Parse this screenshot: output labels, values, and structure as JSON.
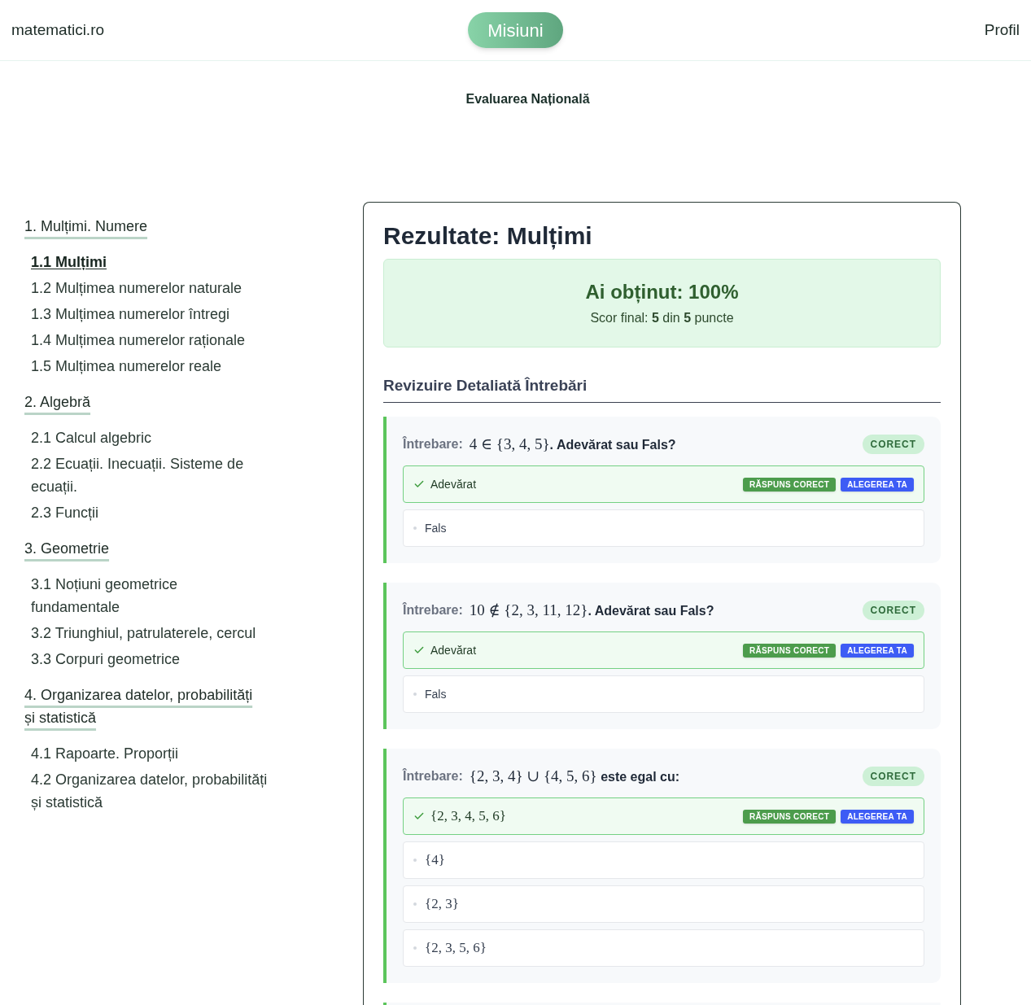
{
  "header": {
    "site_name": "matematici.ro",
    "nav_button": "Misiuni",
    "profile_link": "Profil"
  },
  "page_title": "Evaluarea Națională",
  "sidebar": {
    "sections": [
      {
        "title": "1. Mulțimi. Numere",
        "items": [
          {
            "label": "1.1 Mulțimi",
            "selected": true
          },
          {
            "label": "1.2 Mulțimea numerelor naturale",
            "selected": false
          },
          {
            "label": "1.3 Mulțimea numerelor întregi",
            "selected": false
          },
          {
            "label": "1.4 Mulțimea numerelor raționale",
            "selected": false
          },
          {
            "label": "1.5 Mulțimea numerelor reale",
            "selected": false
          }
        ]
      },
      {
        "title": "2. Algebră",
        "items": [
          {
            "label": "2.1 Calcul algebric",
            "selected": false
          },
          {
            "label": "2.2 Ecuații. Inecuații. Sisteme de ecuații.",
            "selected": false
          },
          {
            "label": "2.3 Funcții",
            "selected": false
          }
        ]
      },
      {
        "title": "3. Geometrie",
        "items": [
          {
            "label": "3.1 Noțiuni geometrice fundamentale",
            "selected": false
          },
          {
            "label": "3.2 Triunghiul, patrulaterele, cercul",
            "selected": false
          },
          {
            "label": "3.3 Corpuri geometrice",
            "selected": false
          }
        ]
      },
      {
        "title": "4. Organizarea datelor, probabilități și statistică",
        "items": [
          {
            "label": "4.1 Rapoarte. Proporții",
            "selected": false
          },
          {
            "label": "4.2 Organizarea datelor, probabilități și statistică",
            "selected": false
          }
        ]
      }
    ]
  },
  "results": {
    "title": "Rezultate: Mulțimi",
    "score": {
      "headline": "Ai obținut: 100%",
      "detail": "Scor final: **5** din **5** puncte"
    },
    "review_heading": "Revizuire Detaliată Întrebări",
    "questions": [
      {
        "label": "Întrebare:",
        "parts": [
          {
            "kind": "math",
            "text": "4 ∈ {3, 4, 5}"
          },
          {
            "kind": "text",
            "text": ". Adevărat sau Fals?"
          }
        ],
        "status": {
          "kind": "correct",
          "label": "CORECT"
        },
        "options": [
          {
            "kind": "text",
            "text": "Adevărat",
            "correct": true,
            "badges": [
              {
                "kind": "correct",
                "label": "RĂSPUNS CORECT"
              },
              {
                "kind": "chosen",
                "label": "ALEGEREA TA"
              }
            ]
          },
          {
            "kind": "text",
            "text": "Fals",
            "correct": false
          }
        ]
      },
      {
        "label": "Întrebare:",
        "parts": [
          {
            "kind": "math",
            "text": "10 ∉ {2, 3, 11, 12}"
          },
          {
            "kind": "text",
            "text": ". Adevărat sau Fals?"
          }
        ],
        "status": {
          "kind": "correct",
          "label": "CORECT"
        },
        "options": [
          {
            "kind": "text",
            "text": "Adevărat",
            "correct": true,
            "badges": [
              {
                "kind": "correct",
                "label": "RĂSPUNS CORECT"
              },
              {
                "kind": "chosen",
                "label": "ALEGEREA TA"
              }
            ]
          },
          {
            "kind": "text",
            "text": "Fals",
            "correct": false
          }
        ]
      },
      {
        "label": "Întrebare:",
        "parts": [
          {
            "kind": "math",
            "text": "{2, 3, 4} ∪ {4, 5, 6}"
          },
          {
            "kind": "text",
            "text": " este egal cu:"
          }
        ],
        "status": {
          "kind": "correct",
          "label": "CORECT"
        },
        "options": [
          {
            "kind": "math",
            "text": "{2, 3, 4, 5, 6}",
            "correct": true,
            "badges": [
              {
                "kind": "correct",
                "label": "RĂSPUNS CORECT"
              },
              {
                "kind": "chosen",
                "label": "ALEGEREA TA"
              }
            ]
          },
          {
            "kind": "math",
            "text": "{4}",
            "correct": false
          },
          {
            "kind": "math",
            "text": "{2, 3}",
            "correct": false
          },
          {
            "kind": "math",
            "text": "{2, 3, 5, 6}",
            "correct": false
          }
        ]
      },
      {
        "status": {
          "kind": "correct"
        }
      }
    ]
  }
}
